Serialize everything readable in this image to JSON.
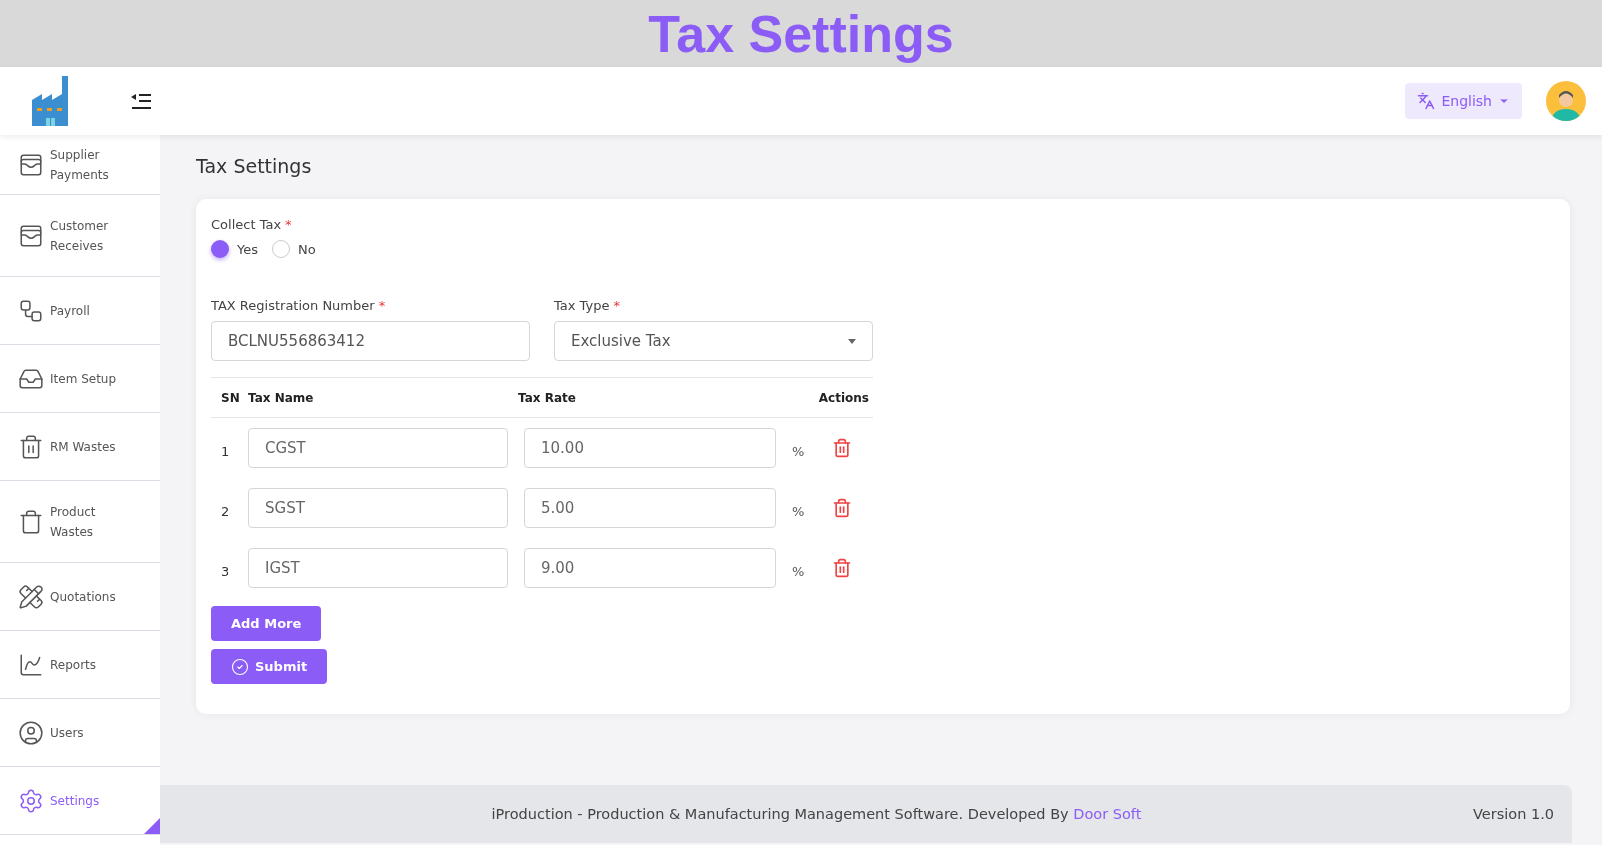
{
  "banner": {
    "title": "Tax Settings"
  },
  "header": {
    "language": "English"
  },
  "sidebar": {
    "items": [
      {
        "label": "Supplier Payments",
        "selected": false
      },
      {
        "label": "Customer Receives",
        "selected": false
      },
      {
        "label": "Payroll",
        "selected": false
      },
      {
        "label": "Item Setup",
        "selected": false
      },
      {
        "label": "RM Wastes",
        "selected": false
      },
      {
        "label": "Product Wastes",
        "selected": false
      },
      {
        "label": "Quotations",
        "selected": false
      },
      {
        "label": "Reports",
        "selected": false
      },
      {
        "label": "Users",
        "selected": false
      },
      {
        "label": "Settings",
        "selected": true
      }
    ]
  },
  "page": {
    "title": "Tax Settings"
  },
  "form": {
    "collect_tax": {
      "label": "Collect Tax",
      "required_mark": "*",
      "options": [
        {
          "label": "Yes",
          "selected": true
        },
        {
          "label": "No",
          "selected": false
        }
      ]
    },
    "registration": {
      "label": "TAX Registration Number",
      "required_mark": "*",
      "value": "BCLNU556863412"
    },
    "tax_type": {
      "label": "Tax Type",
      "required_mark": "*",
      "value": "Exclusive Tax"
    },
    "table": {
      "columns": [
        "SN",
        "Tax Name",
        "Tax Rate",
        "Actions"
      ],
      "rows": [
        {
          "sn": "1",
          "name": "CGST",
          "rate": "10.00",
          "unit": "%"
        },
        {
          "sn": "2",
          "name": "SGST",
          "rate": "5.00",
          "unit": "%"
        },
        {
          "sn": "3",
          "name": "IGST",
          "rate": "9.00",
          "unit": "%"
        }
      ]
    },
    "add_button": "Add More",
    "submit_button": "Submit"
  },
  "footer": {
    "text": "iProduction - Production & Manufacturing Management Software. Developed By",
    "link": "Door Soft",
    "version": "Version 1.0"
  }
}
